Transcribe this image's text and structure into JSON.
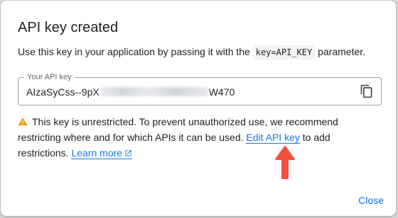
{
  "dialog": {
    "title": "API key created",
    "description_before": "Use this key in your application by passing it with the ",
    "description_code": "key=API_KEY",
    "description_after": " parameter.",
    "key_field": {
      "label": "Your API key",
      "value_prefix": "AIzaSyCss--9pX",
      "value_suffix": "W470"
    },
    "warning": {
      "text": "This key is unrestricted. To prevent unauthorized use, we recommend restricting where and for which APIs it can be used. ",
      "edit_link": "Edit API key",
      "after_link": " to add restrictions. ",
      "learn_more": "Learn more"
    },
    "close_label": "Close"
  },
  "icons": {
    "copy": "copy-icon",
    "warning": "warning-icon",
    "external_link": "external-link-icon",
    "annotation_arrow": "arrow-up-icon"
  },
  "colors": {
    "accent": "#1a73e8",
    "warning": "#f29900",
    "arrow": "#f0513f"
  }
}
